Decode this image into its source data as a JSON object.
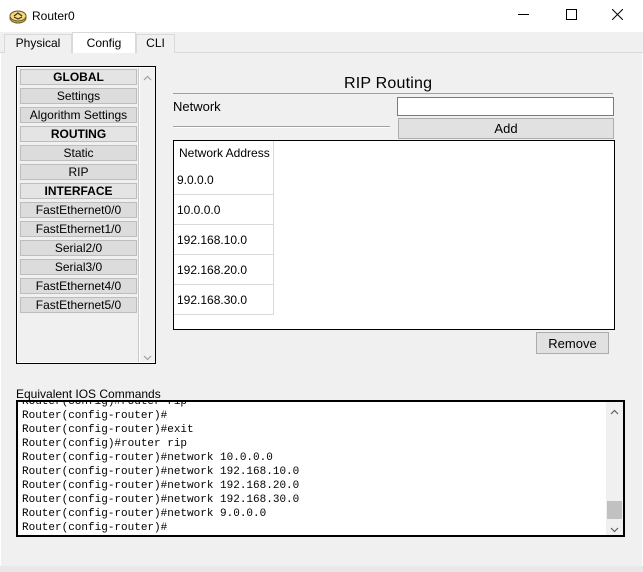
{
  "window": {
    "title": "Router0",
    "controls": {
      "minimize": "minimize",
      "maximize": "maximize",
      "close": "close"
    }
  },
  "tabs": [
    {
      "label": "Physical",
      "active": false
    },
    {
      "label": "Config",
      "active": true
    },
    {
      "label": "CLI",
      "active": false
    }
  ],
  "sidebar": {
    "items": [
      {
        "label": "GLOBAL",
        "header": true
      },
      {
        "label": "Settings",
        "header": false
      },
      {
        "label": "Algorithm Settings",
        "header": false
      },
      {
        "label": "ROUTING",
        "header": true
      },
      {
        "label": "Static",
        "header": false
      },
      {
        "label": "RIP",
        "header": false
      },
      {
        "label": "INTERFACE",
        "header": true
      },
      {
        "label": "FastEthernet0/0",
        "header": false
      },
      {
        "label": "FastEthernet1/0",
        "header": false
      },
      {
        "label": "Serial2/0",
        "header": false
      },
      {
        "label": "Serial3/0",
        "header": false
      },
      {
        "label": "FastEthernet4/0",
        "header": false
      },
      {
        "label": "FastEthernet5/0",
        "header": false
      }
    ]
  },
  "rip": {
    "title": "RIP Routing",
    "network_label": "Network",
    "network_value": "",
    "add_label": "Add",
    "table_header": "Network Address",
    "networks": [
      "9.0.0.0",
      "10.0.0.0",
      "192.168.10.0",
      "192.168.20.0",
      "192.168.30.0"
    ],
    "remove_label": "Remove"
  },
  "ios": {
    "label": "Equivalent IOS Commands",
    "lines": [
      "Router(config)#router rip",
      "Router(config-router)#",
      "Router(config-router)#exit",
      "Router(config)#router rip",
      "Router(config-router)#network 10.0.0.0",
      "Router(config-router)#network 192.168.10.0",
      "Router(config-router)#network 192.168.20.0",
      "Router(config-router)#network 192.168.30.0",
      "Router(config-router)#network 9.0.0.0",
      "Router(config-router)#"
    ]
  },
  "colors": {
    "panel_bg": "#f0f0f0",
    "button_bg": "#e1e1e1",
    "sidebar_item_bg": "#dcdcdc"
  }
}
